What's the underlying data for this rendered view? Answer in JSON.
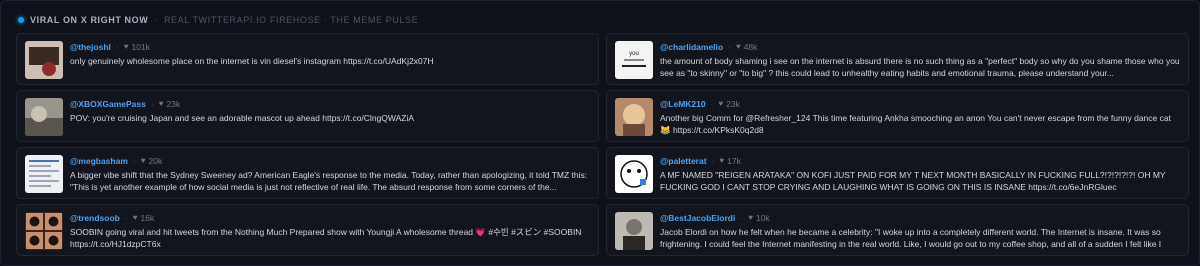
{
  "header": {
    "title": "VIRAL ON X RIGHT NOW",
    "separator": "·",
    "subtitle": "REAL TWITTERAPI.IO FIREHOSE · THE MEME PULSE"
  },
  "posts": [
    {
      "handle": "@thejoshl",
      "likes": "101k",
      "text": "only genuinely wholesome place on the internet is vin diesel's instagram https://t.co/UAdKj2x07H",
      "thumb_icon": "photo-thumbnail-icon",
      "thumb_colors": [
        "#cdbfb3",
        "#3a2a22",
        "#8c2e2a"
      ]
    },
    {
      "handle": "@charlidamelio",
      "likes": "48k",
      "text": "the amount of body shaming i see on the internet is absurd there is no such thing as a \"perfect\" body so why do you shame those who you see as \"to skinny\" or \"to big\" ? this could lead to unhealthy eating habits and emotional trauma, please understand your...",
      "thumb_icon": "handwritten-note-icon",
      "thumb_colors": [
        "#f4f4f2",
        "#222222",
        "#888888"
      ]
    },
    {
      "handle": "@XBOXGamePass",
      "likes": "23k",
      "text": "POV: you're cruising Japan and see an adorable mascot up ahead https://t.co/ClngQWAZiA",
      "thumb_icon": "video-thumbnail-icon",
      "thumb_colors": [
        "#9a958a",
        "#5a564e",
        "#c9c3b5"
      ]
    },
    {
      "handle": "@LeMK210",
      "likes": "23k",
      "text": "Another big Comm for @Refresher_124 This time featuring Ankha smooching an anon You can't never escape from the funny dance cat 😹 https://t.co/KPksK0q2d8",
      "thumb_icon": "artwork-thumbnail-icon",
      "thumb_colors": [
        "#b58a6a",
        "#e8c59b",
        "#6b4a3a"
      ]
    },
    {
      "handle": "@megbasham",
      "likes": "20k",
      "text": "A bigger vibe shift that the Sydney Sweeney ad? American Eagle's response to the media. Today, rather than apologizing, it told TMZ this: \"This is yet another example of how social media is just not reflective of real life. The absurd response from some corners of the...",
      "thumb_icon": "document-screenshot-icon",
      "thumb_colors": [
        "#eef0f4",
        "#9fa6b6",
        "#4b6fb0"
      ]
    },
    {
      "handle": "@paletterat",
      "likes": "17k",
      "text": "A MF NAMED \"REIGEN ARATAKA\" ON KOFI JUST PAID FOR MY T NEXT MONTH BASICALLY IN FUCKING FULL?!?!?!?!?! OH MY FUCKING GOD I CANT STOP CRYING AND LAUGHING WHAT IS GOING ON THIS IS INSANE https://t.co/6eJnRGluec",
      "thumb_icon": "cartoon-avatar-icon",
      "thumb_colors": [
        "#ffffff",
        "#111111",
        "#3c7be0"
      ]
    },
    {
      "handle": "@trendsoob",
      "likes": "16k",
      "text": "SOOBIN going viral and hit tweets from the Nothing Much Prepared show with Youngji A wholesome thread 💗 #수빈 #スビン #SOOBIN https://t.co/HJ1dzpCT6x",
      "thumb_icon": "photo-grid-icon",
      "thumb_colors": [
        "#3a2620",
        "#c98f6f",
        "#1c1412"
      ]
    },
    {
      "handle": "@BestJacobElordi",
      "likes": "10k",
      "text": "Jacob Elordi on how he felt when he became a celebrity: \"I woke up into a completely different world. The Internet is insane. It was so frightening. I could feel the Internet manifesting in the real world. Like, I would go out to my coffee shop, and all of a sudden I felt like I",
      "thumb_icon": "portrait-photo-icon",
      "thumb_colors": [
        "#bdbab4",
        "#2a2725",
        "#7a746c"
      ]
    }
  ]
}
